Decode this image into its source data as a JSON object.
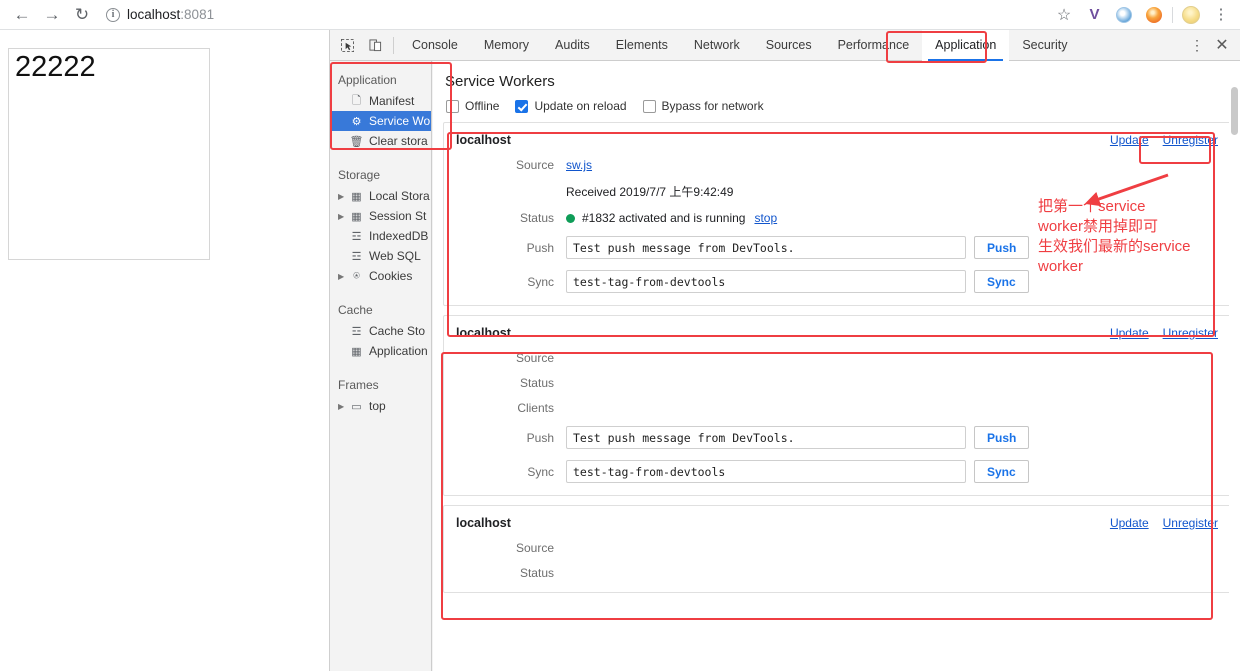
{
  "browser": {
    "nav": {
      "back_icon": "arrow-left-icon",
      "forward_icon": "arrow-right-icon",
      "reload_icon": "reload-icon",
      "back_glyph": "←",
      "forward_glyph": "→",
      "reload_glyph": "↻"
    },
    "omnibox": {
      "info_glyph": "i",
      "host": "localhost",
      "port": ":8081",
      "full_url": "localhost:8081"
    },
    "toolbar_icons": [
      {
        "name": "bookmark-star-icon",
        "glyph": "☆"
      },
      {
        "name": "extension-v-icon",
        "glyph": "V"
      },
      {
        "name": "extension-blue-orb-icon",
        "glyph": ""
      },
      {
        "name": "extension-orange-orb-icon",
        "glyph": ""
      },
      {
        "name": "profile-avatar-icon",
        "glyph": "●"
      },
      {
        "name": "chrome-menu-icon",
        "glyph": "⋮"
      }
    ]
  },
  "page": {
    "box_text": "22222"
  },
  "devtools": {
    "tool_icons": [
      {
        "name": "inspect-element-icon",
        "glyph": "⬚"
      },
      {
        "name": "device-toolbar-icon",
        "glyph": "❐"
      }
    ],
    "tabs": [
      {
        "label": "Console",
        "active": false
      },
      {
        "label": "Memory",
        "active": false
      },
      {
        "label": "Audits",
        "active": false
      },
      {
        "label": "Elements",
        "active": false
      },
      {
        "label": "Network",
        "active": false
      },
      {
        "label": "Sources",
        "active": false
      },
      {
        "label": "Performance",
        "active": false
      },
      {
        "label": "Application",
        "active": true
      },
      {
        "label": "Security",
        "active": false
      }
    ],
    "right_controls": {
      "more_glyph": "⋮",
      "close_glyph": "✕"
    },
    "sidebar": {
      "sections": [
        {
          "title": "Application",
          "items": [
            {
              "label": "Manifest",
              "icon": "manifest-file-icon",
              "glyph": "🗋",
              "selected": false,
              "expandable": false
            },
            {
              "label": "Service Wo",
              "icon": "service-worker-gear-icon",
              "glyph": "⚙",
              "selected": true,
              "expandable": false
            },
            {
              "label": "Clear stora",
              "icon": "trash-icon",
              "glyph": "🗑",
              "selected": false,
              "expandable": false
            }
          ]
        },
        {
          "title": "Storage",
          "items": [
            {
              "label": "Local Stora",
              "icon": "local-storage-grid-icon",
              "glyph": "▦",
              "selected": false,
              "expandable": true
            },
            {
              "label": "Session St",
              "icon": "session-storage-grid-icon",
              "glyph": "▦",
              "selected": false,
              "expandable": true
            },
            {
              "label": "IndexedDB",
              "icon": "database-icon",
              "glyph": "☲",
              "selected": false,
              "expandable": false
            },
            {
              "label": "Web SQL",
              "icon": "database-icon",
              "glyph": "☲",
              "selected": false,
              "expandable": false
            },
            {
              "label": "Cookies",
              "icon": "cookie-icon",
              "glyph": "⍟",
              "selected": false,
              "expandable": true
            }
          ]
        },
        {
          "title": "Cache",
          "items": [
            {
              "label": "Cache Sto",
              "icon": "cache-storage-icon",
              "glyph": "☲",
              "selected": false,
              "expandable": false
            },
            {
              "label": "Application",
              "icon": "application-cache-icon",
              "glyph": "▦",
              "selected": false,
              "expandable": false
            }
          ]
        },
        {
          "title": "Frames",
          "items": [
            {
              "label": "top",
              "icon": "frame-icon",
              "glyph": "▭",
              "selected": false,
              "expandable": true
            }
          ]
        }
      ]
    },
    "service_workers": {
      "title": "Service Workers",
      "options": [
        {
          "label": "Offline",
          "checked": false
        },
        {
          "label": "Update on reload",
          "checked": true
        },
        {
          "label": "Bypass for network",
          "checked": false
        }
      ],
      "labels": {
        "source": "Source",
        "status": "Status",
        "clients": "Clients",
        "push": "Push",
        "sync": "Sync",
        "update": "Update",
        "unregister": "Unregister",
        "stop": "stop"
      },
      "cards": [
        {
          "origin": "localhost",
          "source_file": "sw.js",
          "received": "Received 2019/7/7 上午9:42:49",
          "status_text": "#1832 activated and is running",
          "status_color": "#0f9d58",
          "has_stop": true,
          "show_clients": false,
          "push_value": "Test push message from DevTools.",
          "sync_value": "test-tag-from-devtools",
          "push_button": "Push",
          "sync_button": "Sync"
        },
        {
          "origin": "localhost",
          "source_file": "",
          "received": "",
          "status_text": "",
          "status_color": "",
          "has_stop": false,
          "show_clients": true,
          "push_value": "Test push message from DevTools.",
          "sync_value": "test-tag-from-devtools",
          "push_button": "Push",
          "sync_button": "Sync"
        },
        {
          "origin": "localhost",
          "source_file": "",
          "received": "",
          "status_text": "",
          "status_color": "",
          "has_stop": false,
          "show_clients": false,
          "push_value": "",
          "sync_value": "",
          "push_button": "",
          "sync_button": ""
        }
      ]
    }
  },
  "annotations": {
    "note_text": "把第一个service\nworker禁用掉即可\n生效我们最新的service\nworker",
    "color": "#ef3e42",
    "boxes": [
      {
        "name": "annotation-box-application-tab"
      },
      {
        "name": "annotation-box-sidebar-application"
      },
      {
        "name": "annotation-box-first-worker-card"
      },
      {
        "name": "annotation-box-unregister-link"
      },
      {
        "name": "annotation-box-remaining-workers"
      }
    ]
  }
}
